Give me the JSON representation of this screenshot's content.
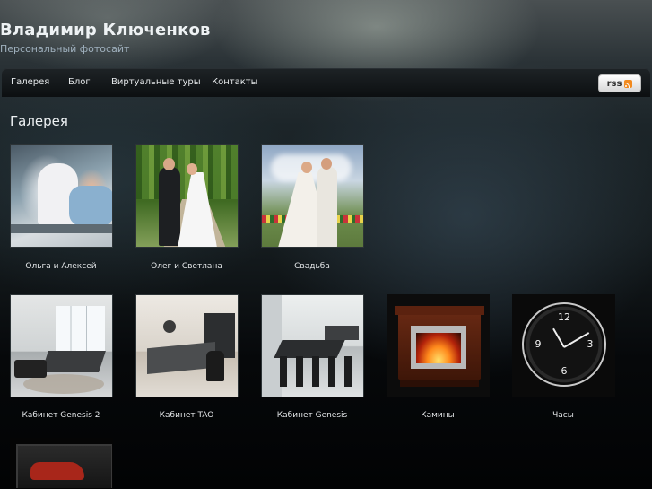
{
  "site": {
    "title": "Владимир Ключенков",
    "tagline": "Персональный фотосайт"
  },
  "nav": {
    "items": [
      {
        "label": "Галерея"
      },
      {
        "label": "Блог"
      },
      {
        "label": "Виртуальные туры"
      },
      {
        "label": "Контакты"
      }
    ],
    "rss_label": "rss"
  },
  "page": {
    "heading": "Галерея"
  },
  "gallery": [
    {
      "caption": "Ольга и Алексей",
      "icon": "wedding-photo"
    },
    {
      "caption": "Олег и Светлана",
      "icon": "wedding-photo"
    },
    {
      "caption": "Свадьба",
      "icon": "wedding-photo"
    },
    {
      "caption": "Кабинет Genesis 2",
      "icon": "office-photo"
    },
    {
      "caption": "Кабинет TAO",
      "icon": "office-photo"
    },
    {
      "caption": "Кабинет Genesis",
      "icon": "office-photo"
    },
    {
      "caption": "Камины",
      "icon": "fireplace-photo"
    },
    {
      "caption": "Часы",
      "icon": "clock-photo"
    },
    {
      "caption": "",
      "icon": "tv-photo"
    }
  ],
  "colors": {
    "rss_orange": "#f28a1e",
    "nav_bg": "#0c0f11",
    "text": "#e6e9eb"
  }
}
